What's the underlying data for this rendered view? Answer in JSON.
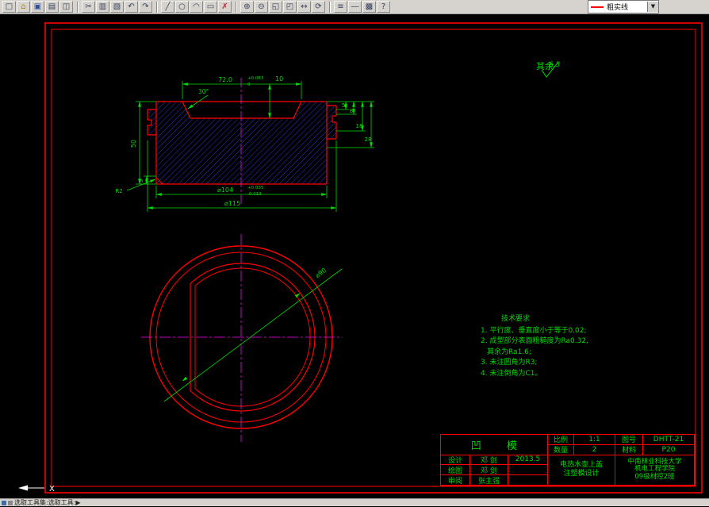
{
  "toolbar": {
    "items": [
      {
        "name": "new",
        "glyph": "□"
      },
      {
        "name": "open",
        "glyph": "⌂"
      },
      {
        "name": "save",
        "glyph": "▣"
      },
      {
        "name": "print",
        "glyph": "▤"
      },
      {
        "name": "preview",
        "glyph": "◫"
      },
      {
        "name": "cut",
        "glyph": "✂"
      },
      {
        "name": "copy",
        "glyph": "▥"
      },
      {
        "name": "paste",
        "glyph": "▧"
      },
      {
        "name": "undo",
        "glyph": "↶"
      },
      {
        "name": "redo",
        "glyph": "↷"
      },
      {
        "name": "line",
        "glyph": "╱"
      },
      {
        "name": "circle",
        "glyph": "○"
      },
      {
        "name": "arc",
        "glyph": "◠"
      },
      {
        "name": "rectangle",
        "glyph": "▭"
      },
      {
        "name": "erase",
        "glyph": "✗"
      },
      {
        "name": "zoom-in",
        "glyph": "⊕"
      },
      {
        "name": "zoom-out",
        "glyph": "⊖"
      },
      {
        "name": "zoom-window",
        "glyph": "◱"
      },
      {
        "name": "zoom-all",
        "glyph": "◰"
      },
      {
        "name": "pan",
        "glyph": "↔"
      },
      {
        "name": "redraw",
        "glyph": "⟳"
      },
      {
        "name": "layers",
        "glyph": "≡"
      },
      {
        "name": "linetype",
        "glyph": "―"
      },
      {
        "name": "color",
        "glyph": "▩"
      },
      {
        "name": "help",
        "glyph": "?"
      }
    ],
    "layer_combo": {
      "value": "粗实线",
      "arrow": "▼"
    }
  },
  "drawing": {
    "surface_note": {
      "label": "其余",
      "value": "6.3"
    },
    "section": {
      "w72": "72.0",
      "w72_up": "+0.083",
      "w72_dn": "0",
      "d10": "10",
      "a30": "30°",
      "r5": "5",
      "r8": "8",
      "r18": "18",
      "r28": "28",
      "h50": "50",
      "h5": "5",
      "r2": "R2",
      "d104": "⌀104",
      "d104_up": "+0.035",
      "d104_dn": "-0.013",
      "d115": "⌀115"
    },
    "circle": {
      "d90": "⌀90"
    },
    "tech_req": {
      "title": "技术要求",
      "lines": [
        "1. 平行度、垂直度小于等于0.02;",
        "2. 成型部分表面粗糙度为Ra0.32,",
        "其余为Ra1.6;",
        "3. 未注圆角为R3;",
        "4. 未注倒角为C1。"
      ]
    },
    "title_block": {
      "part_name": "凹 模",
      "scale_label": "比例",
      "scale_value": "1:1",
      "qty_label": "数量",
      "qty_value": "2",
      "drawing_no_label": "图号",
      "drawing_no_value": "DHTT-21",
      "material_label": "材料",
      "material_value": "P20",
      "rows": [
        {
          "role": "设计",
          "name": "邓 剑",
          "date": "2013.5"
        },
        {
          "role": "绘图",
          "name": "邓 剑",
          "date": ""
        },
        {
          "role": "审阅",
          "name": "张主强",
          "date": ""
        }
      ],
      "project_line1": "电热水壶上盖",
      "project_line2": "注塑模设计",
      "org_line1": "中南林业科技大学",
      "org_line2": "机电工程学院",
      "org_line3": "09级材控2班"
    },
    "axis_label": "X"
  },
  "status_bar": {
    "text": "选取工具集:选取工具:▶"
  },
  "colors": {
    "frame": "#ff0000",
    "outline": "#ff0000",
    "dimension": "#00dd00",
    "centerline": "#ff00ff",
    "hatch": "#3232cd"
  }
}
